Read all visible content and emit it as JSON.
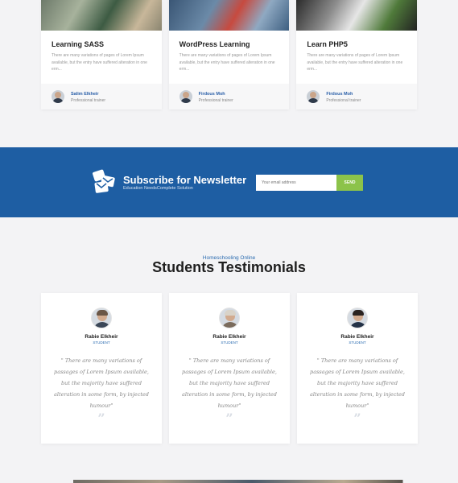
{
  "courses": [
    {
      "title": "Learning SASS",
      "description": "There are many variations of pages of Lorem Ipsum available, but the entry have suffered alteration in one erm...",
      "author": "Salim Elkheir",
      "role": "Professional trainer"
    },
    {
      "title": "WordPress Learning",
      "description": "There are many variations of pages of Lorem Ipsum available, but the entry have suffered alteration in one erm...",
      "author": "Firdous Moh",
      "role": "Professional trainer"
    },
    {
      "title": "Learn PHP5",
      "description": "There are many variations of pages of Lorem Ipsum available, but the entry have suffered alteration in one erm...",
      "author": "Firdous Moh",
      "role": "Professional trainer"
    }
  ],
  "newsletter": {
    "title": "Subscribe for Newsletter",
    "subtitle": "Education NeedsComplete Solution",
    "placeholder": "Your email address",
    "button": "SEND",
    "bg_color": "#1e5ea3",
    "button_color": "#8cc34a"
  },
  "testimonials": {
    "eyebrow": "Homeschooling Online",
    "title": "Students Testimonials",
    "items": [
      {
        "name": "Rabie Elkheir",
        "role": "STUDENT",
        "quote": "\" There are many variations of passages of Lorem Ipsum available, but the majority have suffered alteration in some form, by injected humour\""
      },
      {
        "name": "Rabie Elkheir",
        "role": "STUDENT",
        "quote": "\" There are many variations of passages of Lorem Ipsum available, but the majority have suffered alteration in some form, by injected humour\""
      },
      {
        "name": "Rabie Elkheir",
        "role": "STUDENT",
        "quote": "\" There are many variations of passages of Lorem Ipsum available, but the majority have suffered alteration in some form, by injected humour\""
      }
    ],
    "quote_mark": "”"
  }
}
